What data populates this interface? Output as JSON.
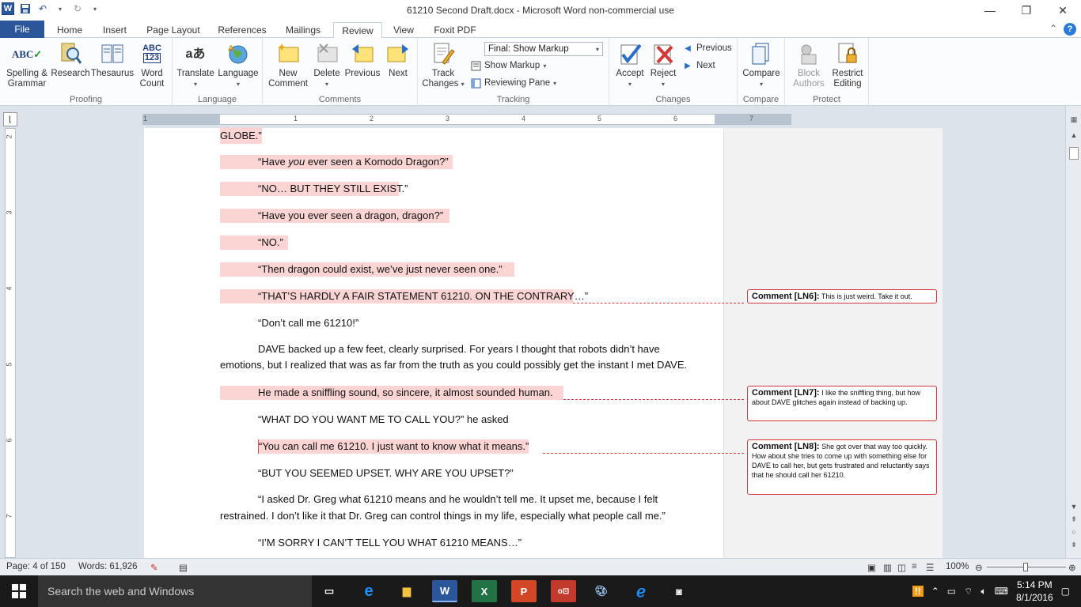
{
  "window": {
    "title": "61210 Second Draft.docx  -  Microsoft Word non-commercial use",
    "controls": [
      "minimize",
      "restore",
      "close"
    ]
  },
  "tabs": [
    "File",
    "Home",
    "Insert",
    "Page Layout",
    "References",
    "Mailings",
    "Review",
    "View",
    "Foxit PDF"
  ],
  "active_tab": "Review",
  "ribbon": {
    "proofing": {
      "label": "Proofing",
      "spelling_line1": "Spelling &",
      "spelling_line2": "Grammar",
      "research": "Research",
      "thesaurus": "Thesaurus",
      "wordcount_line1": "Word",
      "wordcount_line2": "Count"
    },
    "language": {
      "label": "Language",
      "translate": "Translate",
      "language": "Language"
    },
    "comments": {
      "label": "Comments",
      "new_line1": "New",
      "new_line2": "Comment",
      "delete": "Delete",
      "previous": "Previous",
      "next": "Next"
    },
    "tracking": {
      "label": "Tracking",
      "track_line1": "Track",
      "track_line2": "Changes",
      "display_for_review": "Final: Show Markup",
      "show_markup": "Show Markup",
      "reviewing_pane": "Reviewing Pane"
    },
    "changes": {
      "label": "Changes",
      "accept": "Accept",
      "reject": "Reject",
      "previous": "Previous",
      "next": "Next"
    },
    "compare": {
      "label": "Compare",
      "compare": "Compare"
    },
    "protect": {
      "label": "Protect",
      "block_line1": "Block",
      "block_line2": "Authors",
      "restrict_line1": "Restrict",
      "restrict_line2": "Editing"
    }
  },
  "ruler_numbers": [
    "1",
    "1",
    "2",
    "3",
    "4",
    "5",
    "6",
    "7"
  ],
  "vruler_numbers": [
    "2",
    "3",
    "4",
    "5",
    "6",
    "7"
  ],
  "document": {
    "p0": "GLOBE.”",
    "p1_pre": "“Have ",
    "p1_em": "you",
    "p1_post": " ever seen a Komodo Dragon?”",
    "p2": "“NO… BUT THEY STILL EXIST.”",
    "p3": "“Have you ever seen a dragon, dragon?”",
    "p4": "“NO.”",
    "p5": "“Then dragon could exist, we’ve just never seen one.”",
    "p6": "“THAT’S HARDLY A FAIR STATEMENT 61210. ON THE CONTRARY…”",
    "p7": "“Don’t call me 61210!”",
    "p8_line1": "DAVE backed up a few feet, clearly surprised. For years I thought that robots didn’t have",
    "p8_line2": "emotions, but I realized that was as far from the truth as you could possibly get the instant I met DAVE.",
    "p9": "He made a sniffling sound, so sincere, it almost sounded human.",
    "p10": "“WHAT DO YOU WANT ME TO CALL YOU?” he asked",
    "p11": "“You can call me 61210. I just want to know what it means.”",
    "p12": "“BUT YOU SEEMED UPSET. WHY ARE YOU UPSET?”",
    "p13_line1": "“I asked Dr. Greg what 61210  means and he wouldn’t tell me. It upset me, because I felt",
    "p13_line2": "restrained. I don’t like it that Dr. Greg can control things in my life, especially what people call me.”",
    "p14": "“I’M SORRY I CAN’T TELL YOU WHAT 61210  MEANS…”"
  },
  "comments": [
    {
      "tag": "Comment [LN6]:",
      "text": "This is just weird. Take it out."
    },
    {
      "tag": "Comment [LN7]:",
      "text": "I like the sniffling thing, but how about DAVE glitches again instead of backing up."
    },
    {
      "tag": "Comment [LN8]:",
      "text": "She got over that way too quickly. How about she tries to come up with something else for DAVE to call her, but gets frustrated and reluctantly says that he should call her 61210."
    }
  ],
  "status": {
    "page": "Page: 4 of 150",
    "words": "Words: 61,926",
    "zoom": "100%"
  },
  "taskbar": {
    "search_placeholder": "Search the web and Windows",
    "time": "5:14 PM",
    "date": "8/1/2016"
  }
}
